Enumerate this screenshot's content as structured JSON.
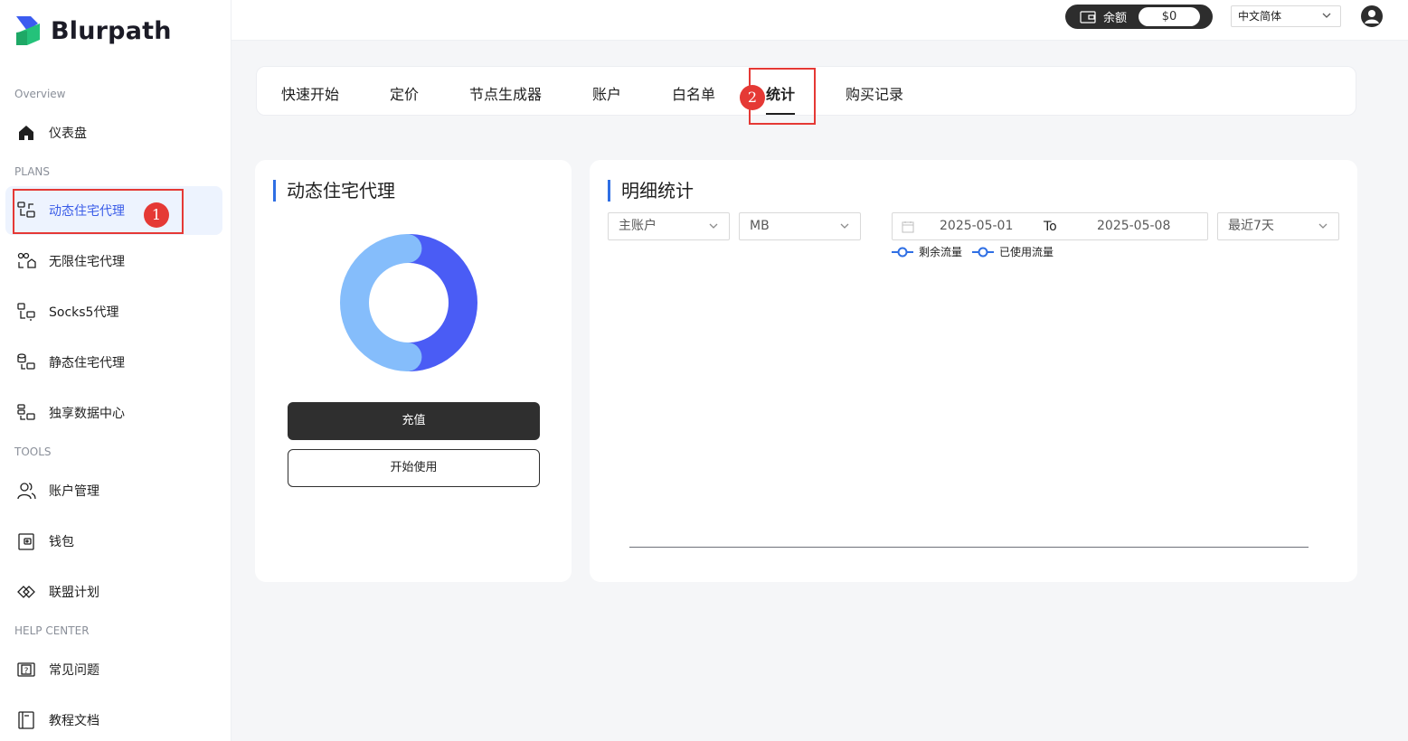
{
  "brand": {
    "name": "Blurpath"
  },
  "sidebar": {
    "sections": {
      "overview": "Overview",
      "plans": "PLANS",
      "tools": "TOOLS",
      "help": "HELP CENTER"
    },
    "items": [
      {
        "label": "仪表盘",
        "icon": "home-icon"
      },
      {
        "label": "动态住宅代理",
        "icon": "residential-proxy-icon",
        "active": true
      },
      {
        "label": "无限住宅代理",
        "icon": "unlimited-proxy-icon"
      },
      {
        "label": "Socks5代理",
        "icon": "socks5-icon"
      },
      {
        "label": "静态住宅代理",
        "icon": "static-proxy-icon"
      },
      {
        "label": "独享数据中心",
        "icon": "datacenter-icon"
      },
      {
        "label": "账户管理",
        "icon": "users-icon"
      },
      {
        "label": "钱包",
        "icon": "wallet-icon"
      },
      {
        "label": "联盟计划",
        "icon": "affiliate-icon"
      },
      {
        "label": "常见问题",
        "icon": "faq-icon"
      },
      {
        "label": "教程文档",
        "icon": "docs-icon"
      }
    ]
  },
  "topbar": {
    "balance_label": "余额",
    "balance_value": "$0",
    "language": "中文简体"
  },
  "tabs": [
    {
      "label": "快速开始"
    },
    {
      "label": "定价"
    },
    {
      "label": "节点生成器"
    },
    {
      "label": "账户"
    },
    {
      "label": "白名单"
    },
    {
      "label": "统计",
      "active": true
    },
    {
      "label": "购买记录"
    }
  ],
  "annotations": {
    "badge1": "1",
    "badge2": "2"
  },
  "left_card": {
    "title": "动态住宅代理",
    "recharge_button": "充值",
    "start_button": "开始使用",
    "donut": {
      "segments": [
        {
          "value": 50,
          "color": "#4a5cf5"
        },
        {
          "value": 50,
          "color": "#85bdfb"
        }
      ]
    }
  },
  "right_card": {
    "title": "明细统计",
    "account_select": "主账户",
    "unit_select": "MB",
    "date_start": "2025-05-01",
    "date_to": "To",
    "date_end": "2025-05-08",
    "range_select": "最近7天",
    "legend": [
      {
        "label": "剩余流量",
        "color": "#2f6fe4"
      },
      {
        "label": "已使用流量",
        "color": "#2f6fe4"
      }
    ]
  },
  "colors": {
    "accent": "#3a5ce8",
    "annotation": "#e53935",
    "dark_button": "#2f2f2f"
  }
}
